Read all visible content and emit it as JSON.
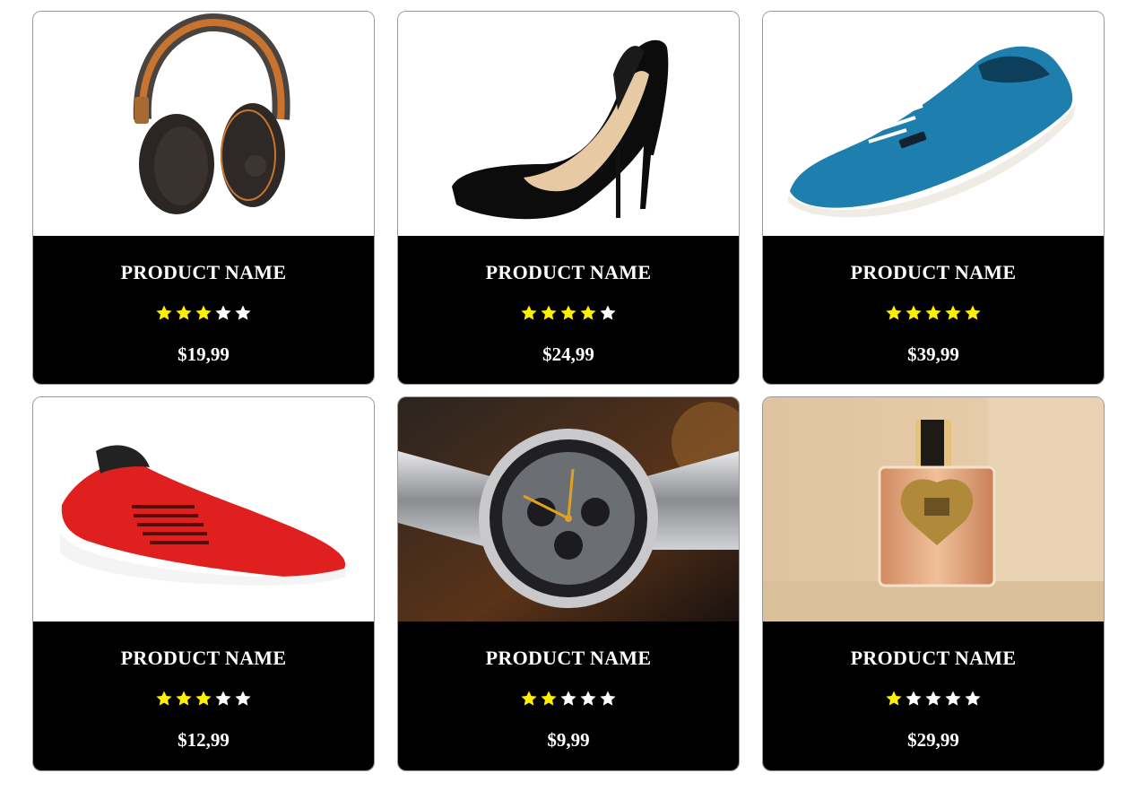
{
  "colors": {
    "star_filled": "#ffef00",
    "star_empty": "#ffffff",
    "info_background": "#000000"
  },
  "products": [
    {
      "name": "PRODUCT NAME",
      "rating": 3,
      "rating_max": 5,
      "price": "$19,99",
      "image": "headphones-image"
    },
    {
      "name": "PRODUCT NAME",
      "rating": 4,
      "rating_max": 5,
      "price": "$24,99",
      "image": "black-heels-image"
    },
    {
      "name": "PRODUCT NAME",
      "rating": 5,
      "rating_max": 5,
      "price": "$39,99",
      "image": "blue-sneaker-image"
    },
    {
      "name": "PRODUCT NAME",
      "rating": 3,
      "rating_max": 5,
      "price": "$12,99",
      "image": "red-sneaker-image"
    },
    {
      "name": "PRODUCT NAME",
      "rating": 2,
      "rating_max": 5,
      "price": "$9,99",
      "image": "wristwatch-image"
    },
    {
      "name": "PRODUCT NAME",
      "rating": 1,
      "rating_max": 5,
      "price": "$29,99",
      "image": "perfume-image"
    }
  ]
}
